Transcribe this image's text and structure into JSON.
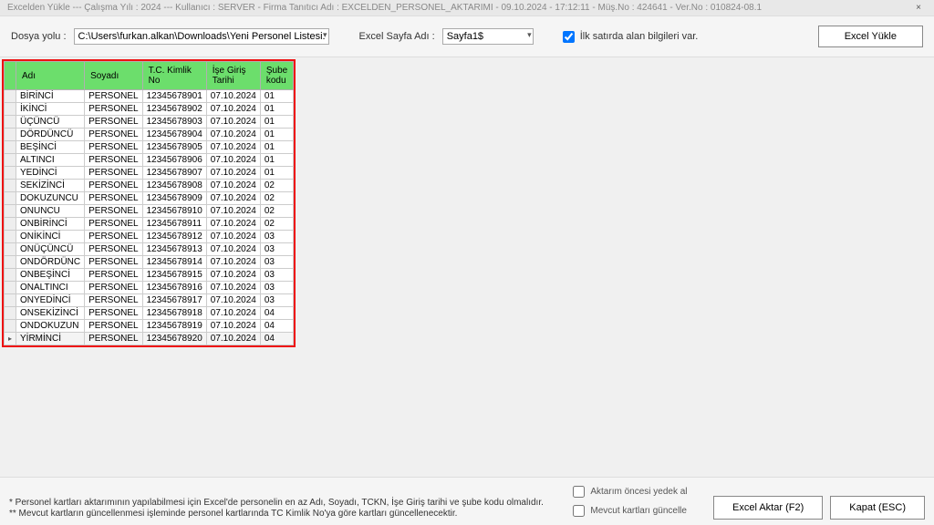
{
  "title": "Excelden Yükle  ---  Çalışma Yılı : 2024  ---  Kullanıcı : SERVER - Firma Tanıtıcı Adı : EXCELDEN_PERSONEL_AKTARIMI - 09.10.2024 - 17:12:11 - Müş.No : 424641 - Ver.No : 010824-08.1",
  "toolbar": {
    "path_label": "Dosya yolu :",
    "path_value": "C:\\Users\\furkan.alkan\\Downloads\\Yeni Personel Listesi.xlsx",
    "sheet_label": "Excel Sayfa Adı :",
    "sheet_value": "Sayfa1$",
    "firstrow_label": "İlk satırda alan bilgileri var.",
    "load_label": "Excel Yükle"
  },
  "columns": {
    "adi": "Adı",
    "soyadi": "Soyadı",
    "tc": "T.C. Kimlik No",
    "ise": "İşe Giriş Tarihi",
    "sube": "Şube kodu"
  },
  "rows": [
    {
      "adi": "BİRİNCİ",
      "soyadi": "PERSONEL",
      "tc": "12345678901",
      "ise": "07.10.2024",
      "sube": "01"
    },
    {
      "adi": "İKİNCİ",
      "soyadi": "PERSONEL",
      "tc": "12345678902",
      "ise": "07.10.2024",
      "sube": "01"
    },
    {
      "adi": "ÜÇÜNCÜ",
      "soyadi": "PERSONEL",
      "tc": "12345678903",
      "ise": "07.10.2024",
      "sube": "01"
    },
    {
      "adi": "DÖRDÜNCÜ",
      "soyadi": "PERSONEL",
      "tc": "12345678904",
      "ise": "07.10.2024",
      "sube": "01"
    },
    {
      "adi": "BEŞİNCİ",
      "soyadi": "PERSONEL",
      "tc": "12345678905",
      "ise": "07.10.2024",
      "sube": "01"
    },
    {
      "adi": "ALTINCI",
      "soyadi": "PERSONEL",
      "tc": "12345678906",
      "ise": "07.10.2024",
      "sube": "01"
    },
    {
      "adi": "YEDİNCİ",
      "soyadi": "PERSONEL",
      "tc": "12345678907",
      "ise": "07.10.2024",
      "sube": "01"
    },
    {
      "adi": "SEKİZİNCİ",
      "soyadi": "PERSONEL",
      "tc": "12345678908",
      "ise": "07.10.2024",
      "sube": "02"
    },
    {
      "adi": "DOKUZUNCU",
      "soyadi": "PERSONEL",
      "tc": "12345678909",
      "ise": "07.10.2024",
      "sube": "02"
    },
    {
      "adi": "ONUNCU",
      "soyadi": "PERSONEL",
      "tc": "12345678910",
      "ise": "07.10.2024",
      "sube": "02"
    },
    {
      "adi": "ONBİRİNCİ",
      "soyadi": "PERSONEL",
      "tc": "12345678911",
      "ise": "07.10.2024",
      "sube": "02"
    },
    {
      "adi": "ONİKİNCİ",
      "soyadi": "PERSONEL",
      "tc": "12345678912",
      "ise": "07.10.2024",
      "sube": "03"
    },
    {
      "adi": "ONÜÇÜNCÜ",
      "soyadi": "PERSONEL",
      "tc": "12345678913",
      "ise": "07.10.2024",
      "sube": "03"
    },
    {
      "adi": "ONDÖRDÜNC",
      "soyadi": "PERSONEL",
      "tc": "12345678914",
      "ise": "07.10.2024",
      "sube": "03"
    },
    {
      "adi": "ONBEŞİNCİ",
      "soyadi": "PERSONEL",
      "tc": "12345678915",
      "ise": "07.10.2024",
      "sube": "03"
    },
    {
      "adi": "ONALTINCI",
      "soyadi": "PERSONEL",
      "tc": "12345678916",
      "ise": "07.10.2024",
      "sube": "03"
    },
    {
      "adi": "ONYEDİNCİ",
      "soyadi": "PERSONEL",
      "tc": "12345678917",
      "ise": "07.10.2024",
      "sube": "03"
    },
    {
      "adi": "ONSEKİZİNCİ",
      "soyadi": "PERSONEL",
      "tc": "12345678918",
      "ise": "07.10.2024",
      "sube": "04"
    },
    {
      "adi": "ONDOKUZUN",
      "soyadi": "PERSONEL",
      "tc": "12345678919",
      "ise": "07.10.2024",
      "sube": "04"
    },
    {
      "adi": "YİRMİNCİ",
      "soyadi": "PERSONEL",
      "tc": "12345678920",
      "ise": "07.10.2024",
      "sube": "04"
    }
  ],
  "footer": {
    "note1": "* Personel kartları aktarımının yapılabilmesi için Excel'de personelin en az Adı, Soyadı, TCKN, İşe Giriş tarihi ve şube kodu olmalıdır.",
    "note2": "** Mevcut kartların güncellenmesi işleminde personel kartlarında TC Kimlik No'ya göre kartları güncellenecektir.",
    "opt_backup": "Aktarım öncesi yedek al",
    "opt_update": "Mevcut kartları güncelle",
    "btn_transfer": "Excel Aktar (F2)",
    "btn_close": "Kapat (ESC)"
  }
}
